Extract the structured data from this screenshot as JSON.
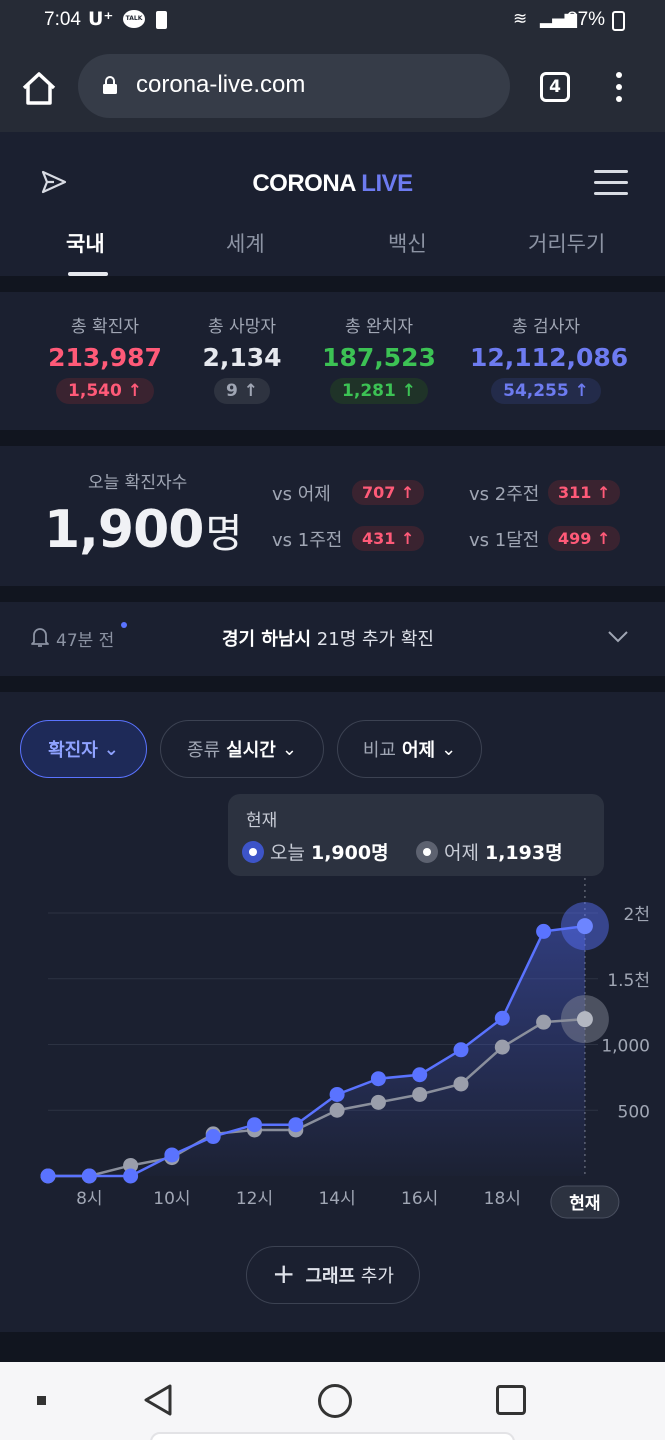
{
  "status_bar": {
    "time": "7:04",
    "carrier": "U⁺",
    "talk": "TALK",
    "battery_pct": "87%"
  },
  "browser": {
    "url": "corona-live.com",
    "tab_count": "4"
  },
  "header": {
    "logo_part1": "CORONA",
    "logo_part2": "LIVE",
    "tabs": [
      {
        "label": "국내",
        "active": true
      },
      {
        "label": "세계",
        "active": false
      },
      {
        "label": "백신",
        "active": false
      },
      {
        "label": "거리두기",
        "active": false
      }
    ]
  },
  "stats": [
    {
      "label": "총 확진자",
      "value": "213,987",
      "change": "1,540 ↑",
      "color": "#ff5a78",
      "badge_bg": "#3a2330"
    },
    {
      "label": "총 사망자",
      "value": "2,134",
      "change": "9 ↑",
      "color": "#a0a6b4",
      "badge_bg": "#2e3340"
    },
    {
      "label": "총 완치자",
      "value": "187,523",
      "change": "1,281 ↑",
      "color": "#3cc254",
      "badge_bg": "#1f3328"
    },
    {
      "label": "총 검사자",
      "value": "12,112,086",
      "change": "54,255 ↑",
      "color": "#6d7bf0",
      "badge_bg": "#232b4a"
    }
  ],
  "today": {
    "label": "오늘 확진자수",
    "number": "1,900",
    "unit": "명",
    "comparisons": [
      {
        "label": "vs 어제",
        "value": "707 ↑"
      },
      {
        "label": "vs 2주전",
        "value": "311 ↑"
      },
      {
        "label": "vs 1주전",
        "value": "431 ↑"
      },
      {
        "label": "vs 1달전",
        "value": "499 ↑"
      }
    ]
  },
  "notice": {
    "time": "47분 전",
    "location": "경기 하남시",
    "text": " 21명 추가 확진"
  },
  "chart_controls": {
    "metric": "확진자",
    "type_label": "종류",
    "type_value": "실시간",
    "compare_label": "비교",
    "compare_value": "어제",
    "add_graph": "그래프 추가",
    "add_graph_bold": "그래프",
    "add_graph_rest": "추가"
  },
  "tooltip": {
    "title": "현재",
    "today_label": "오늘",
    "today_value": "1,900명",
    "yesterday_label": "어제",
    "yesterday_value": "1,193명"
  },
  "chart_data": {
    "type": "line",
    "x": [
      "6시",
      "7시",
      "8시",
      "9시",
      "10시",
      "11시",
      "12시",
      "13시",
      "14시",
      "15시",
      "16시",
      "17시",
      "18시",
      "19시",
      "현재"
    ],
    "xtick_labels": [
      "8시",
      "10시",
      "12시",
      "14시",
      "16시",
      "18시",
      "현재"
    ],
    "ytick_labels": [
      "500",
      "1,000",
      "1.5천",
      "2천"
    ],
    "ylim": [
      0,
      2000
    ],
    "series": [
      {
        "name": "오늘",
        "color": "#5a73ff",
        "values": [
          0,
          0,
          0,
          160,
          300,
          390,
          390,
          620,
          740,
          770,
          960,
          1200,
          1860,
          1900
        ]
      },
      {
        "name": "어제",
        "color": "#8a8f9c",
        "values": [
          0,
          0,
          80,
          140,
          320,
          350,
          350,
          500,
          560,
          620,
          700,
          980,
          1170,
          1193
        ]
      }
    ]
  },
  "colors": {
    "accent": "#5a73ff",
    "confirmed": "#ff5a78",
    "recovered": "#3cc254",
    "tested": "#6d7bf0"
  }
}
